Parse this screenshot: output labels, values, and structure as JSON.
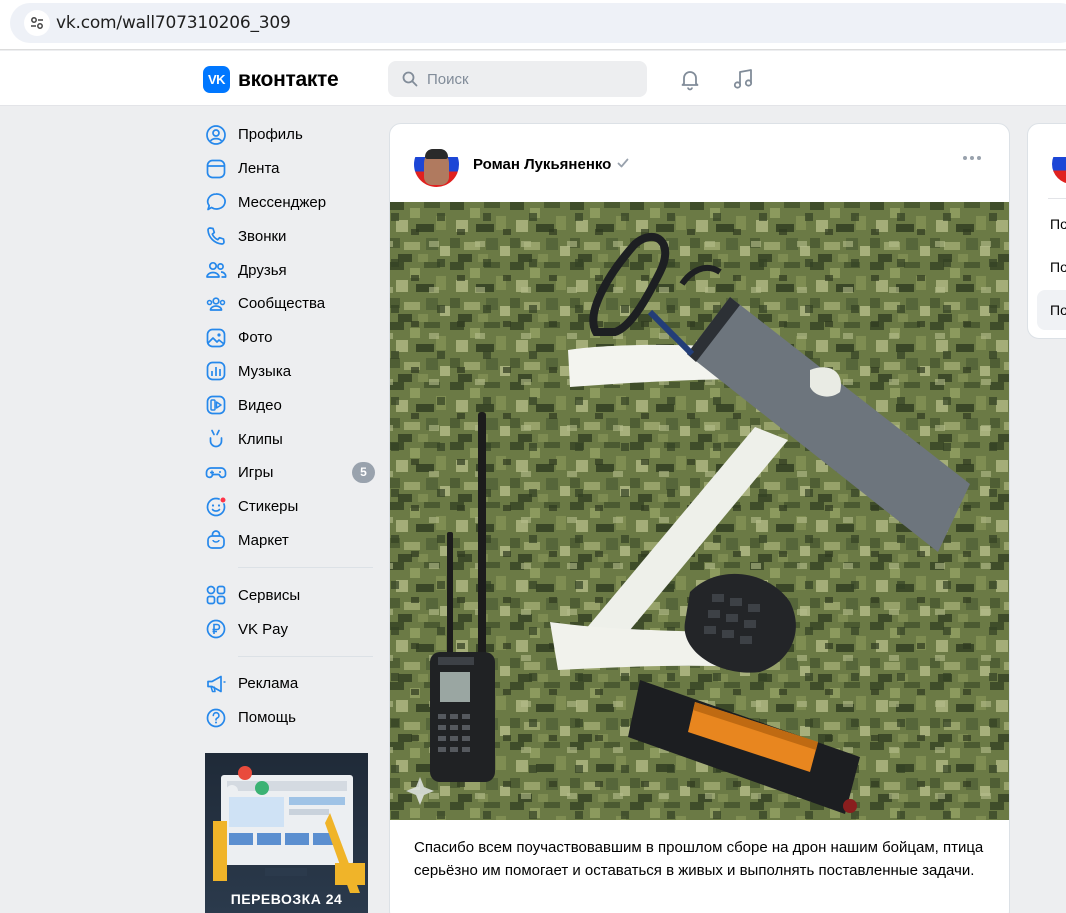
{
  "browser": {
    "url": "vk.com/wall707310206_309"
  },
  "header": {
    "logo_mark": "VK",
    "logo_text": "вконтакте",
    "search_placeholder": "Поиск"
  },
  "sidebar": {
    "items": [
      {
        "label": "Профиль",
        "icon": "profile-icon"
      },
      {
        "label": "Лента",
        "icon": "feed-icon"
      },
      {
        "label": "Мессенджер",
        "icon": "messenger-icon"
      },
      {
        "label": "Звонки",
        "icon": "phone-icon"
      },
      {
        "label": "Друзья",
        "icon": "friends-icon"
      },
      {
        "label": "Сообщества",
        "icon": "communities-icon"
      },
      {
        "label": "Фото",
        "icon": "photo-icon"
      },
      {
        "label": "Музыка",
        "icon": "music-icon"
      },
      {
        "label": "Видео",
        "icon": "video-icon"
      },
      {
        "label": "Клипы",
        "icon": "clips-icon"
      },
      {
        "label": "Игры",
        "icon": "games-icon",
        "badge": "5"
      },
      {
        "label": "Стикеры",
        "icon": "stickers-icon"
      },
      {
        "label": "Маркет",
        "icon": "market-icon"
      }
    ],
    "services": [
      {
        "label": "Сервисы",
        "icon": "services-icon"
      },
      {
        "label": "VK Pay",
        "icon": "vkpay-icon"
      }
    ],
    "footer": [
      {
        "label": "Реклама",
        "icon": "ads-icon"
      },
      {
        "label": "Помощь",
        "icon": "help-icon"
      }
    ],
    "ad_label": "ПЕРЕВОЗКА 24"
  },
  "post": {
    "author": "Роман Лукьяненко",
    "text": "Спасибо всем поучаствовавшим в прошлом сборе на дрон нашим бойцам, птица серьёзно им помогает и оставаться в живых и выполнять поставленные задачи."
  },
  "right_card": {
    "items": [
      "По",
      "По",
      "По"
    ]
  },
  "colors": {
    "accent": "#0077ff",
    "badge": "#99a2ad",
    "background": "#edeef0",
    "sticker_dot": "#ff3347"
  }
}
